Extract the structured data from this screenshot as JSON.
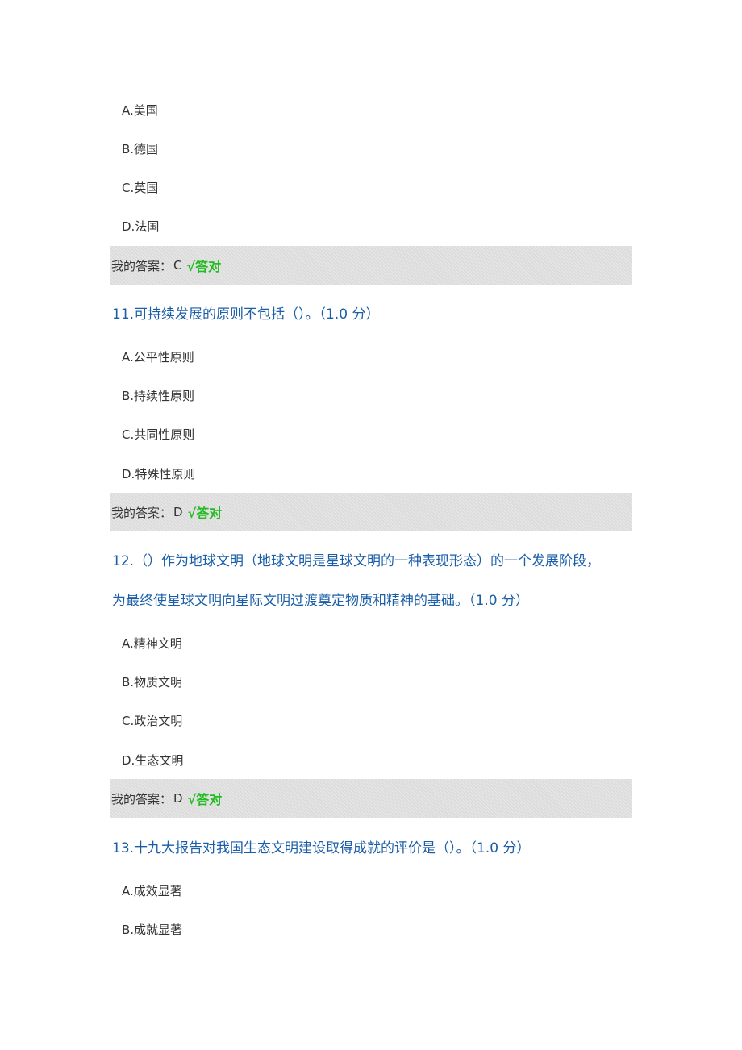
{
  "q10": {
    "options": [
      "A.美国",
      "B.德国",
      "C.英国",
      "D.法国"
    ],
    "answer_label": "我的答案：",
    "answer_value": "C",
    "result": "√答对"
  },
  "q11": {
    "title": "11.可持续发展的原则不包括（）。（1.0 分）",
    "options": [
      "A.公平性原则",
      "B.持续性原则",
      "C.共同性原则",
      "D.特殊性原则"
    ],
    "answer_label": "我的答案：",
    "answer_value": "D",
    "result": "√答对"
  },
  "q12": {
    "title_line1": "12.（）作为地球文明（地球文明是星球文明的一种表现形态）的一个发展阶段，",
    "title_line2": "为最终使星球文明向星际文明过渡奠定物质和精神的基础。（1.0 分）",
    "options": [
      "A.精神文明",
      "B.物质文明",
      "C.政治文明",
      "D.生态文明"
    ],
    "answer_label": "我的答案：",
    "answer_value": "D",
    "result": "√答对"
  },
  "q13": {
    "title": "13.十九大报告对我国生态文明建设取得成就的评价是（）。（1.0 分）",
    "options": [
      "A.成效显著",
      "B.成就显著"
    ]
  }
}
